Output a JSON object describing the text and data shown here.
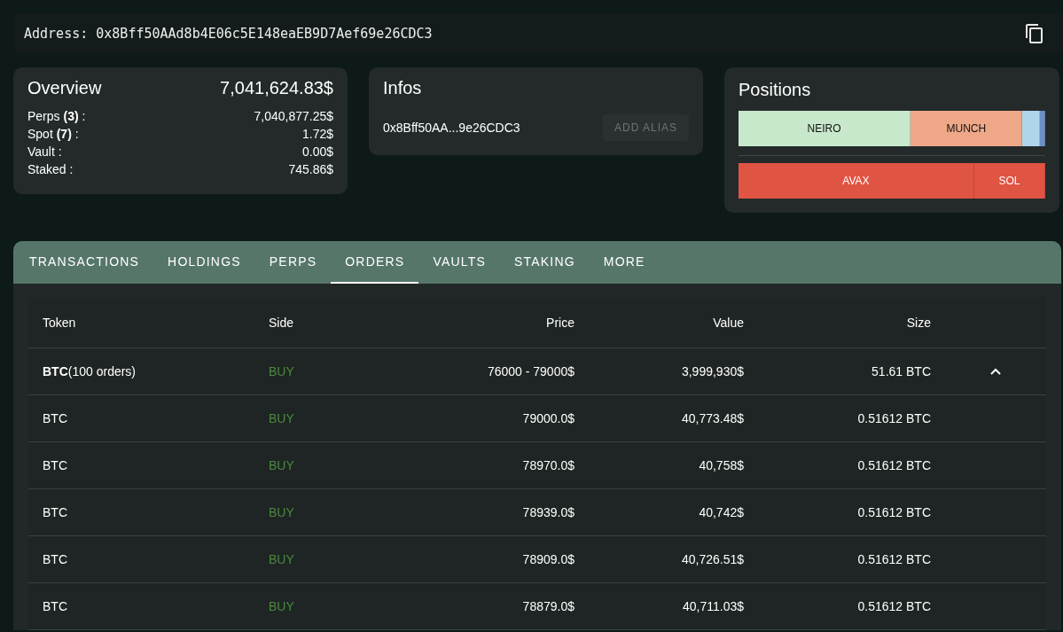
{
  "address": {
    "label": "Address:",
    "value": "0x8Bff50AAd8b4E06c5E148eaEB9D7Aef69e26CDC3"
  },
  "overview": {
    "title": "Overview",
    "total": "7,041,624.83$",
    "rows": [
      {
        "label": "Perps **(3)** :",
        "value": "7,040,877.25$"
      },
      {
        "label": "Spot **(7)** :",
        "value": "1.72$"
      },
      {
        "label": "Vault :",
        "value": "0.00$"
      },
      {
        "label": "Staked :",
        "value": "745.86$"
      }
    ]
  },
  "infos": {
    "title": "Infos",
    "address": "0x8Bff50AA...9e26CDC3",
    "button": "ADD ALIAS"
  },
  "positions": {
    "title": "Positions",
    "rows": [
      [
        {
          "label": "NEIRO",
          "color": "#c8e8cc"
        },
        {
          "label": "MUNCH",
          "color": "#eea888"
        },
        {
          "color": "#b0d4ea"
        },
        {
          "color": "#6c8fc4"
        }
      ],
      [
        {
          "label": "AVAX",
          "color": "#e05444"
        },
        {
          "label": "SOL",
          "color": "#e05444"
        }
      ]
    ]
  },
  "tabs": [
    {
      "label": "TRANSACTIONS",
      "selected": false
    },
    {
      "label": "HOLDINGS",
      "selected": false
    },
    {
      "label": "PERPS",
      "selected": false
    },
    {
      "label": "ORDERS",
      "selected": true
    },
    {
      "label": "VAULTS",
      "selected": false
    },
    {
      "label": "STAKING",
      "selected": false
    },
    {
      "label": "MORE",
      "selected": false
    }
  ],
  "table": {
    "columns": [
      "Token",
      "Side",
      "Price",
      "Value",
      "Size"
    ],
    "group": {
      "token": "BTC",
      "count": "(100 orders)",
      "side": "BUY",
      "price": "76000 - 79000$",
      "value": "3,999,930$",
      "size": "51.61 BTC",
      "expanded": true
    },
    "rows": [
      {
        "token": "BTC",
        "side": "BUY",
        "price": "79000.0$",
        "value": "40,773.48$",
        "size": "0.51612 BTC"
      },
      {
        "token": "BTC",
        "side": "BUY",
        "price": "78970.0$",
        "value": "40,758$",
        "size": "0.51612 BTC"
      },
      {
        "token": "BTC",
        "side": "BUY",
        "price": "78939.0$",
        "value": "40,742$",
        "size": "0.51612 BTC"
      },
      {
        "token": "BTC",
        "side": "BUY",
        "price": "78909.0$",
        "value": "40,726.51$",
        "size": "0.51612 BTC"
      },
      {
        "token": "BTC",
        "side": "BUY",
        "price": "78879.0$",
        "value": "40,711.03$",
        "size": "0.51612 BTC"
      }
    ]
  }
}
